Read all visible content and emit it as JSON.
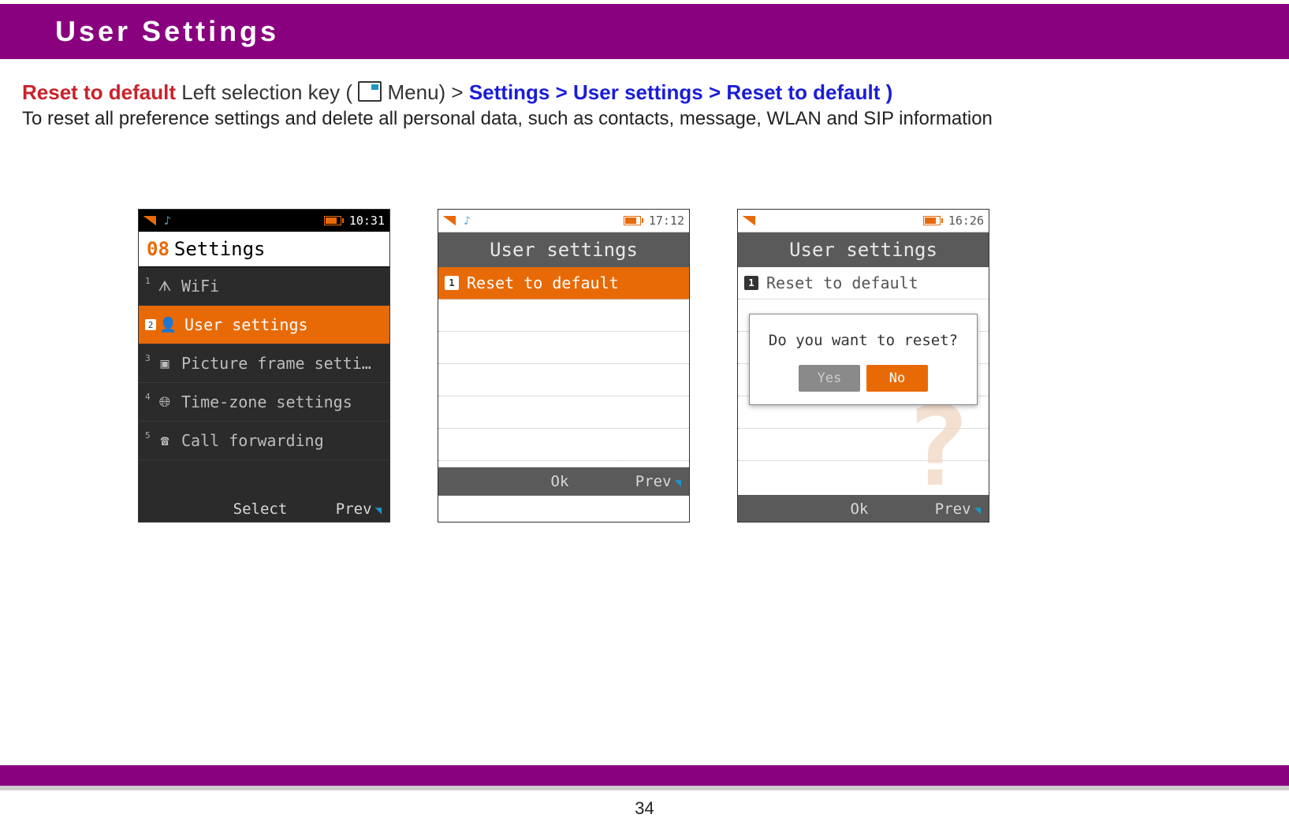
{
  "header": {
    "title": "User Settings"
  },
  "intro": {
    "red": "Reset to default",
    "plain1": " Left selection key ( ",
    "plain2": " Menu) >  ",
    "nav": "Settings > User settings > Reset to default )",
    "desc": "To reset all preference settings and delete all personal data, such as contacts, message, WLAN and SIP information"
  },
  "screen1": {
    "time": "10:31",
    "title_num": "08",
    "title_text": "Settings",
    "items": [
      {
        "idx": "1",
        "icon": "antenna",
        "label": "WiFi"
      },
      {
        "idx": "2",
        "icon": "user-gear",
        "label": "User settings"
      },
      {
        "idx": "3",
        "icon": "frame",
        "label": "Picture frame setti…"
      },
      {
        "idx": "4",
        "icon": "globe",
        "label": "Time-zone settings"
      },
      {
        "idx": "5",
        "icon": "phone",
        "label": "Call forwarding"
      }
    ],
    "soft_center": "Select",
    "soft_right": "Prev"
  },
  "screen2": {
    "time": "17:12",
    "title": "User settings",
    "item_idx": "1",
    "item_label": "Reset to default",
    "soft_center": "Ok",
    "soft_right": "Prev"
  },
  "screen3": {
    "time": "16:26",
    "title": "User settings",
    "item_idx": "1",
    "item_label": "Reset to default",
    "dialog_msg": "Do you want to reset?",
    "dialog_yes": "Yes",
    "dialog_no": "No",
    "soft_center": "Ok",
    "soft_right": "Prev"
  },
  "page_number": "34"
}
